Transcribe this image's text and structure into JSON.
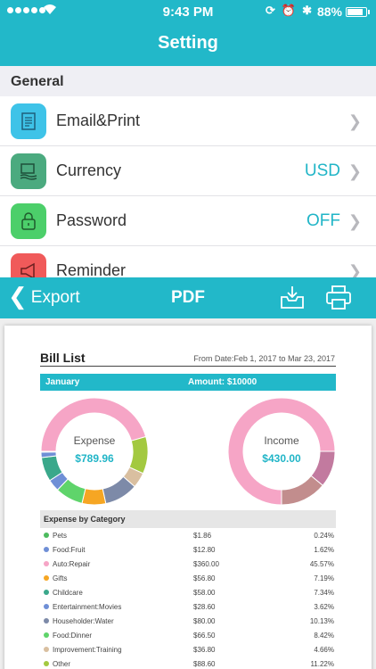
{
  "status_bar": {
    "time": "9:43 PM",
    "battery": "88%"
  },
  "nav": {
    "title": "Setting"
  },
  "general": {
    "section_title": "General",
    "rows": [
      {
        "label": "Email&Print",
        "value": "",
        "icon": "email-print-icon",
        "color": "#3ec3e8"
      },
      {
        "label": "Currency",
        "value": "USD",
        "icon": "currency-icon",
        "color": "#4baa7f"
      },
      {
        "label": "Password",
        "value": "OFF",
        "icon": "lock-icon",
        "color": "#4ccf6a"
      },
      {
        "label": "Reminder",
        "value": "",
        "icon": "megaphone-icon",
        "color": "#f05a5a"
      }
    ]
  },
  "export_bar": {
    "back_label": "Export",
    "title": "PDF"
  },
  "pdf": {
    "title": "Bill List",
    "date_range": "From Date:Feb 1, 2017 to Mar 23, 2017",
    "month": "January",
    "amount": "Amount: $10000",
    "expense_label": "Expense",
    "expense_value": "$789.96",
    "income_label": "Income",
    "income_value": "$430.00",
    "category_header": "Expense by Category",
    "categories": [
      {
        "name": "Pets",
        "amount": "$1.86",
        "pct": "0.24%",
        "color": "#4cbb5e"
      },
      {
        "name": "Food:Fruit",
        "amount": "$12.80",
        "pct": "1.62%",
        "color": "#6f8fd6"
      },
      {
        "name": "Auto:Repair",
        "amount": "$360.00",
        "pct": "45.57%",
        "color": "#f6a5c6"
      },
      {
        "name": "Gifts",
        "amount": "$56.80",
        "pct": "7.19%",
        "color": "#f6a623"
      },
      {
        "name": "Childcare",
        "amount": "$58.00",
        "pct": "7.34%",
        "color": "#3aa88b"
      },
      {
        "name": "Entertainment:Movies",
        "amount": "$28.60",
        "pct": "3.62%",
        "color": "#6f8fd6"
      },
      {
        "name": "Householder:Water",
        "amount": "$80.00",
        "pct": "10.13%",
        "color": "#7d8aa8"
      },
      {
        "name": "Food:Dinner",
        "amount": "$66.50",
        "pct": "8.42%",
        "color": "#5fd46b"
      },
      {
        "name": "Improvement:Training",
        "amount": "$36.80",
        "pct": "4.66%",
        "color": "#d9bfa0"
      },
      {
        "name": "Other",
        "amount": "$88.60",
        "pct": "11.22%",
        "color": "#a3c940"
      }
    ],
    "expense_donut": [
      {
        "value": 45.57,
        "color": "#f6a5c6"
      },
      {
        "value": 11.22,
        "color": "#a3c940"
      },
      {
        "value": 4.66,
        "color": "#d9bfa0"
      },
      {
        "value": 10.13,
        "color": "#7d8aa8"
      },
      {
        "value": 7.19,
        "color": "#f6a623"
      },
      {
        "value": 8.42,
        "color": "#5fd46b"
      },
      {
        "value": 3.62,
        "color": "#6f8fd6"
      },
      {
        "value": 7.34,
        "color": "#3aa88b"
      },
      {
        "value": 1.62,
        "color": "#6f8fd6"
      },
      {
        "value": 0.24,
        "color": "#4cbb5e"
      }
    ],
    "income_donut": [
      {
        "value": 75,
        "color": "#f6a5c6"
      },
      {
        "value": 11,
        "color": "#c27a9f"
      },
      {
        "value": 14,
        "color": "#c28d8d"
      }
    ]
  }
}
